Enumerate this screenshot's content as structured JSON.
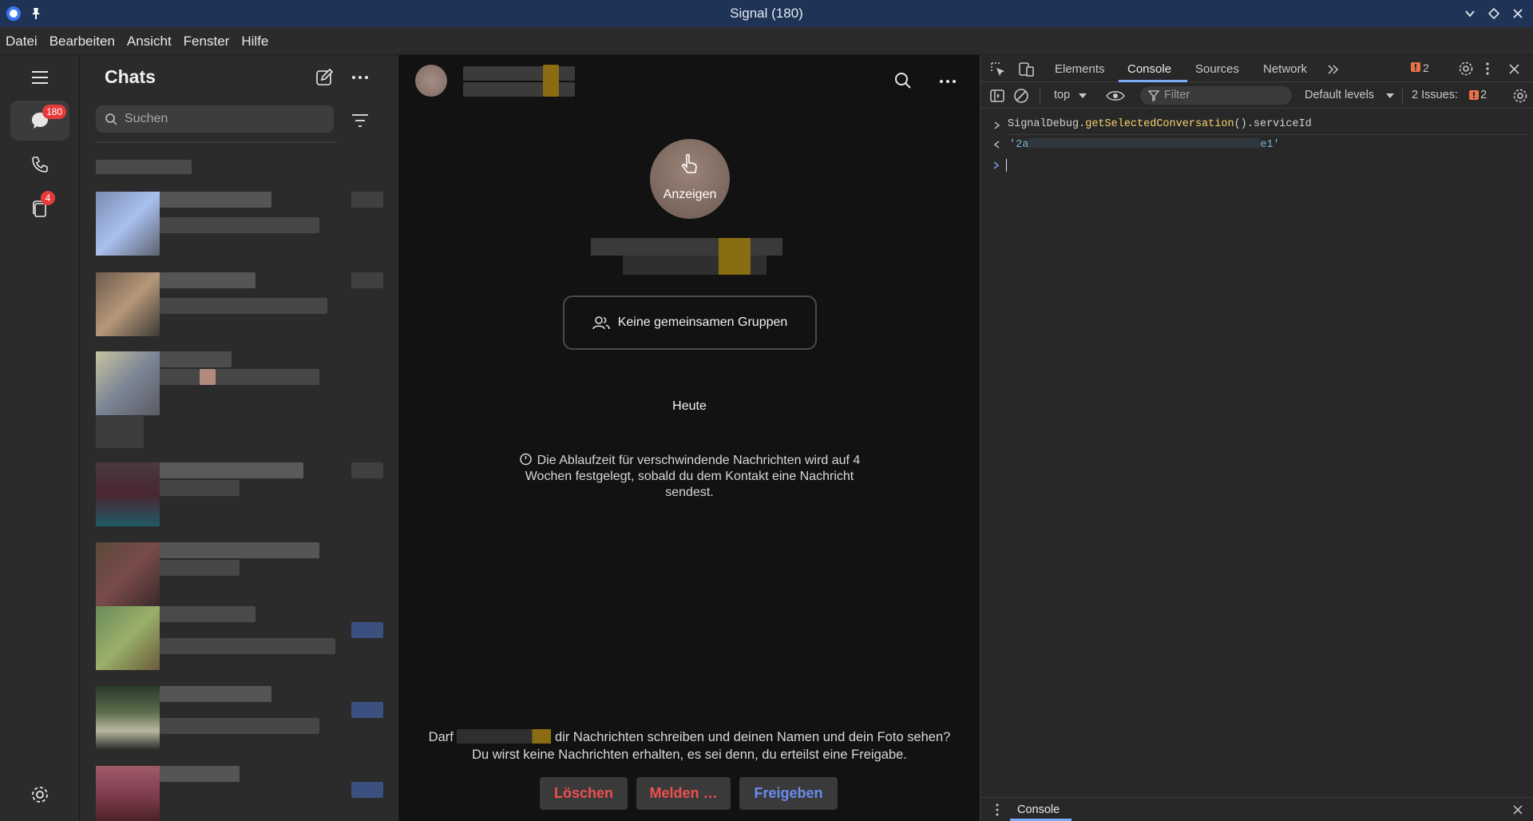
{
  "window": {
    "title": "Signal (180)"
  },
  "menu": [
    "Datei",
    "Bearbeiten",
    "Ansicht",
    "Fenster",
    "Hilfe"
  ],
  "rail": {
    "chats_badge": "180",
    "stories_badge": "4"
  },
  "chatlist": {
    "heading": "Chats",
    "search_placeholder": "Suchen"
  },
  "conversation": {
    "avatar_reveal_label": "Anzeigen",
    "groups_button": "Keine gemeinsamen Gruppen",
    "date_divider": "Heute",
    "timer_notice_line1": "Die Ablaufzeit für verschwindende Nachrichten wird auf 4",
    "timer_notice_line2": "Wochen festgelegt, sobald du dem Kontakt eine Nachricht",
    "timer_notice_line3": "sendest.",
    "request_prefix": "Darf",
    "request_line1_rest": "dir Nachrichten schreiben und deinen Namen und dein Foto sehen?",
    "request_line2": "Du wirst keine Nachrichten erhalten, es sei denn, du erteilst eine Freigabe.",
    "delete_button": "Löschen",
    "report_button": "Melden …",
    "accept_button": "Freigeben"
  },
  "devtools": {
    "tabs": [
      "Elements",
      "Console",
      "Sources",
      "Network"
    ],
    "warnings_count": "2",
    "context": "top",
    "filter_placeholder": "Filter",
    "levels": "Default levels",
    "issues_label": "2 Issues:",
    "issues_count": "2",
    "console_input_object": "SignalDebug.",
    "console_input_method": "getSelectedConversation",
    "console_input_rest": "().serviceId",
    "console_output_start": "'2a",
    "console_output_end": "e1'",
    "drawer_tab": "Console"
  },
  "colors": {
    "titlebar": "#1f3357",
    "accent_blue": "#6a8cf0",
    "danger_red": "#ef4f4f",
    "console_yellow": "#f6d36d"
  }
}
